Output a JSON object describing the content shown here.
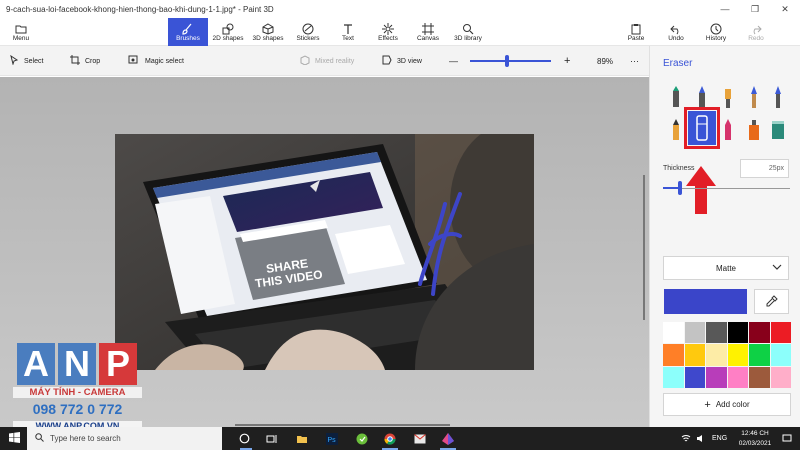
{
  "window": {
    "title": "9-cach-sua-loi-facebook-khong-hien-thong-bao-khi-dung-1-1.jpg* - Paint 3D",
    "minimize": "—",
    "maximize": "❐",
    "close": "✕"
  },
  "ribbon": {
    "menu": "Menu",
    "tabs": [
      {
        "label": "Brushes",
        "icon": "brush-icon",
        "active": true
      },
      {
        "label": "2D shapes",
        "icon": "2d-shapes-icon"
      },
      {
        "label": "3D shapes",
        "icon": "3d-shapes-icon"
      },
      {
        "label": "Stickers",
        "icon": "stickers-icon"
      },
      {
        "label": "Text",
        "icon": "text-icon"
      },
      {
        "label": "Effects",
        "icon": "effects-icon"
      },
      {
        "label": "Canvas",
        "icon": "canvas-icon"
      },
      {
        "label": "3D library",
        "icon": "3d-library-icon"
      }
    ],
    "right": [
      {
        "label": "Paste",
        "icon": "paste-icon"
      },
      {
        "label": "Undo",
        "icon": "undo-icon"
      },
      {
        "label": "History",
        "icon": "history-icon"
      },
      {
        "label": "Redo",
        "icon": "redo-icon",
        "disabled": true
      }
    ],
    "accent": "#3a54d6"
  },
  "toolbar": {
    "select": "Select",
    "crop": "Crop",
    "magic_select": "Magic select",
    "mixed_reality": "Mixed reality",
    "view_3d": "3D view",
    "zoom": "89%",
    "zoom_minus": "—",
    "zoom_plus": "+",
    "more": "···"
  },
  "panel": {
    "title": "Eraser",
    "brushes": [
      {
        "name": "marker-icon",
        "color": "#1b9e77"
      },
      {
        "name": "calligraphy-pen-icon",
        "color": "#3b5ad6"
      },
      {
        "name": "oil-brush-icon",
        "color": "#e8a23a"
      },
      {
        "name": "watercolor-icon",
        "color": "#3b5ad6"
      },
      {
        "name": "pixel-pen-icon",
        "color": "#3b5ad6"
      },
      {
        "name": "pencil-icon",
        "color": "#e8a23a"
      },
      {
        "name": "eraser-icon",
        "color": "#ffffff",
        "selected": true
      },
      {
        "name": "crayon-icon",
        "color": "#d6336c"
      },
      {
        "name": "spray-can-icon",
        "color": "#e86a1a"
      },
      {
        "name": "fill-bucket-icon",
        "color": "#2a8a7a"
      }
    ],
    "thickness_label": "Thickness",
    "thickness_value": "25px",
    "thickness_level": 0.13,
    "material": "Matte",
    "current_color": "#3a45c9",
    "swatches": [
      "#ffffff",
      "#c3c3c3",
      "#585858",
      "#000000",
      "#88001b",
      "#ec1c24",
      "#ff7f27",
      "#ffc90e",
      "#fdeca6",
      "#fff200",
      "#0ed145",
      "#8cfffb",
      "#8cfffb",
      "#3f48cc",
      "#b83dba",
      "#ff7fc5",
      "#9c5a3c",
      "#ffaec9"
    ],
    "add_color": "Add color"
  },
  "logo": {
    "letters": [
      "A",
      "N",
      "P"
    ],
    "tagline": "MÁY TÍNH - CAMERA",
    "phone": "098 772 0 772",
    "site": "WWW.ANP.COM.VN"
  },
  "taskbar": {
    "search_placeholder": "Type here to search",
    "apps": [
      "cortana-icon",
      "task-view-icon",
      "file-explorer-icon",
      "photoshop-icon",
      "zalo-icon",
      "chrome-icon",
      "mail-icon",
      "paint-3d-icon"
    ],
    "lang": "ENG",
    "time": "12:46 CH",
    "date": "02/03/2021"
  }
}
